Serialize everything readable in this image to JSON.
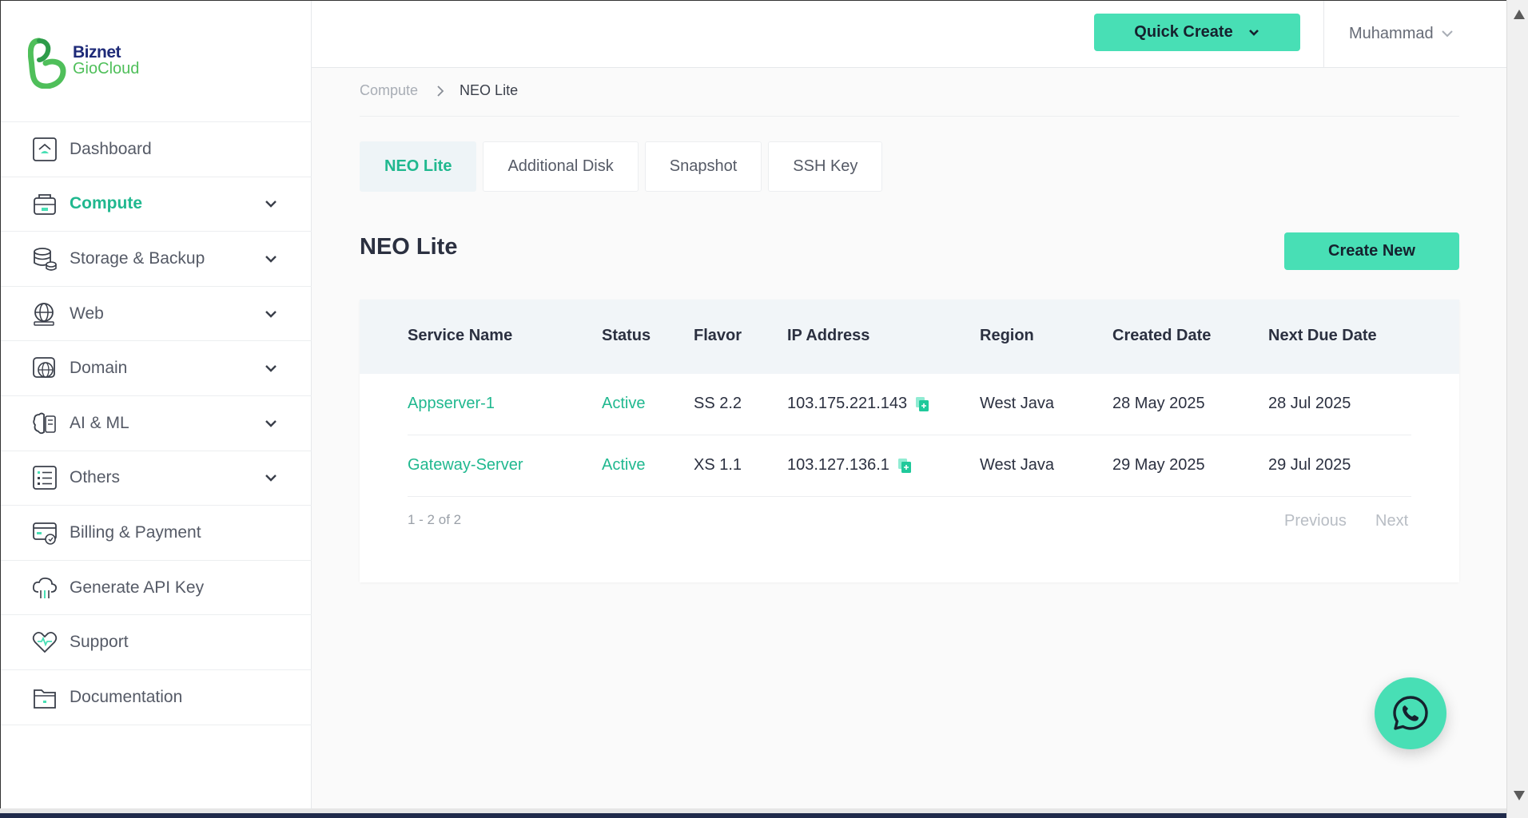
{
  "brand": {
    "line1": "Biznet",
    "line2": "GioCloud"
  },
  "header": {
    "quick_create": "Quick Create",
    "user_name": "Muhammad"
  },
  "sidebar": {
    "items": [
      {
        "label": "Dashboard",
        "icon": "dashboard-icon",
        "expandable": false,
        "active": false
      },
      {
        "label": "Compute",
        "icon": "compute-icon",
        "expandable": true,
        "active": true
      },
      {
        "label": "Storage & Backup",
        "icon": "storage-icon",
        "expandable": true,
        "active": false
      },
      {
        "label": "Web",
        "icon": "web-icon",
        "expandable": true,
        "active": false
      },
      {
        "label": "Domain",
        "icon": "domain-icon",
        "expandable": true,
        "active": false
      },
      {
        "label": "AI & ML",
        "icon": "ai-ml-icon",
        "expandable": true,
        "active": false
      },
      {
        "label": "Others",
        "icon": "others-icon",
        "expandable": true,
        "active": false
      },
      {
        "label": "Billing & Payment",
        "icon": "billing-icon",
        "expandable": false,
        "active": false
      },
      {
        "label": "Generate API Key",
        "icon": "api-key-icon",
        "expandable": false,
        "active": false
      },
      {
        "label": "Support",
        "icon": "support-icon",
        "expandable": false,
        "active": false
      },
      {
        "label": "Documentation",
        "icon": "documentation-icon",
        "expandable": false,
        "active": false
      }
    ]
  },
  "breadcrumb": {
    "parent": "Compute",
    "current": "NEO Lite"
  },
  "tabs": [
    {
      "label": "NEO Lite",
      "active": true
    },
    {
      "label": "Additional Disk",
      "active": false
    },
    {
      "label": "Snapshot",
      "active": false
    },
    {
      "label": "SSH Key",
      "active": false
    }
  ],
  "main": {
    "title": "NEO Lite",
    "create_new": "Create New"
  },
  "table": {
    "columns": [
      "Service Name",
      "Status",
      "Flavor",
      "IP Address",
      "Region",
      "Created Date",
      "Next Due Date"
    ],
    "rows": [
      {
        "service_name": "Appserver-1",
        "status": "Active",
        "flavor": "SS 2.2",
        "ip": "103.175.221.143",
        "region": "West Java",
        "created": "28 May 2025",
        "next_due": "28 Jul 2025"
      },
      {
        "service_name": "Gateway-Server",
        "status": "Active",
        "flavor": "XS 1.1",
        "ip": "103.127.136.1",
        "region": "West Java",
        "created": "29 May 2025",
        "next_due": "29 Jul 2025"
      }
    ],
    "pagination": {
      "count": "1 - 2 of 2",
      "previous": "Previous",
      "next": "Next"
    }
  },
  "colors": {
    "accent": "#48dfb5",
    "accent_text": "#20b88f",
    "brand_blue": "#1e2a78",
    "brand_green": "#4fbf5a"
  }
}
